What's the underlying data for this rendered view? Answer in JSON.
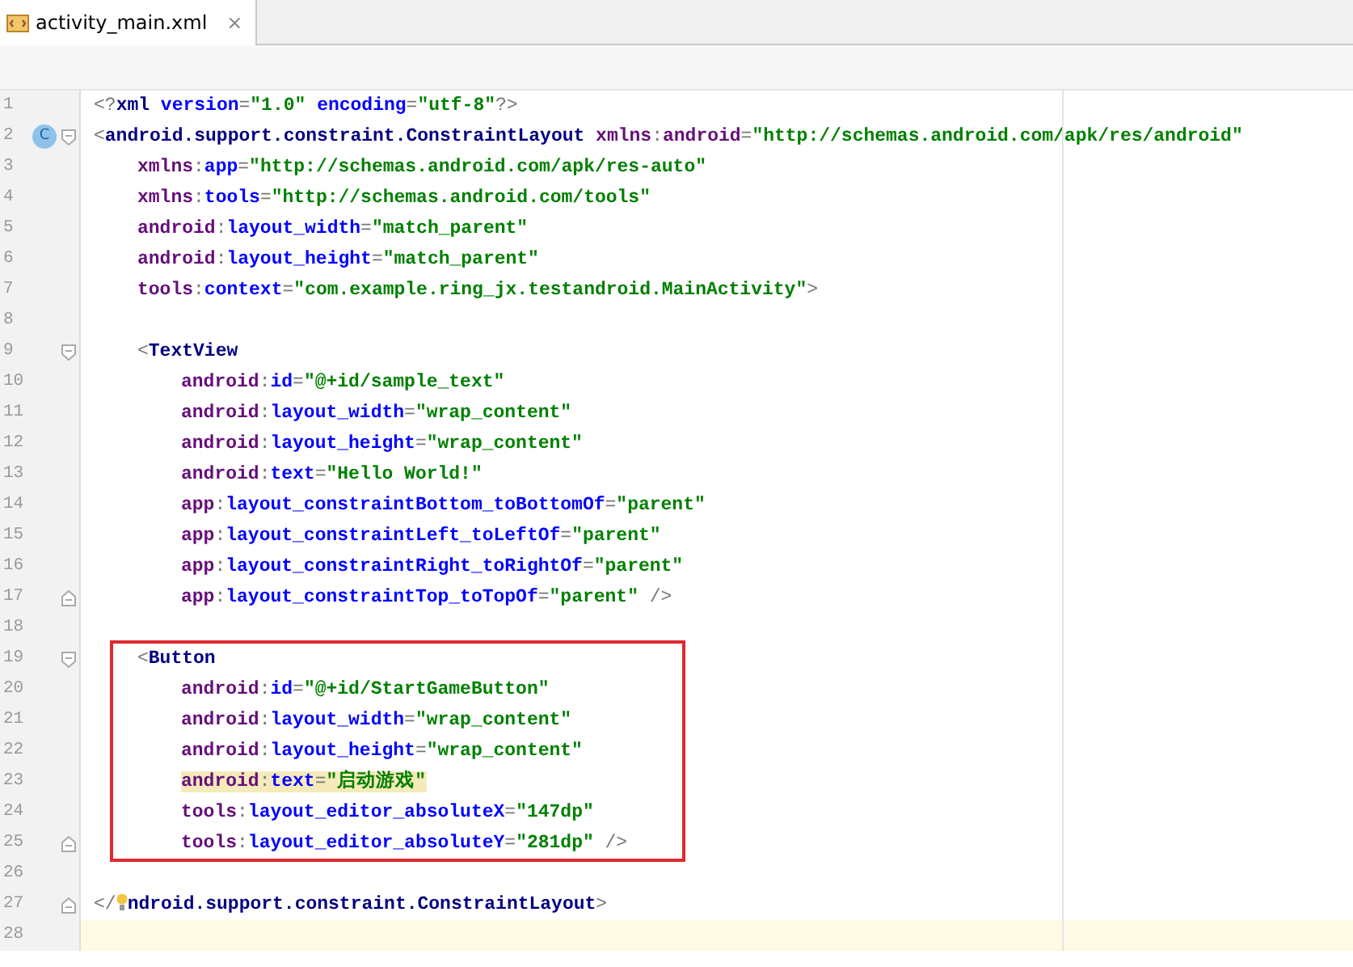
{
  "tab": {
    "title": "activity_main.xml",
    "close": "×",
    "selected": true
  },
  "lines": [
    {
      "number": "1",
      "tokens": [
        {
          "kind": "punct",
          "text": "<?"
        },
        {
          "kind": "tag",
          "text": "xml"
        },
        {
          "kind": "attr",
          "text": " version"
        },
        {
          "kind": "punct",
          "text": "="
        },
        {
          "kind": "value",
          "text": "\"1.0\""
        },
        {
          "kind": "attr",
          "text": " encoding"
        },
        {
          "kind": "punct",
          "text": "="
        },
        {
          "kind": "value",
          "text": "\"utf-8\""
        },
        {
          "kind": "punct",
          "text": "?>"
        }
      ]
    },
    {
      "number": "2",
      "badge": "C",
      "fold_start": true,
      "tokens": [
        {
          "kind": "punct",
          "text": "<"
        },
        {
          "kind": "tag",
          "text": "android.support.constraint.ConstraintLayout"
        },
        {
          "kind": "ns",
          "text": " xmlns"
        },
        {
          "kind": "punct",
          "text": ":"
        },
        {
          "kind": "ns",
          "text": "android"
        },
        {
          "kind": "punct",
          "text": "="
        },
        {
          "kind": "value",
          "text": "\"http://schemas.android.com/apk/res/android\""
        }
      ],
      "children": [
        {
          "number": "3",
          "tokens": [
            {
              "kind": "ns",
              "text": "xmlns"
            },
            {
              "kind": "punct",
              "text": ":"
            },
            {
              "kind": "attr",
              "text": "app"
            },
            {
              "kind": "punct",
              "text": "="
            },
            {
              "kind": "value",
              "text": "\"http://schemas.android.com/apk/res-auto\""
            }
          ]
        },
        {
          "number": "4",
          "tokens": [
            {
              "kind": "ns",
              "text": "xmlns"
            },
            {
              "kind": "punct",
              "text": ":"
            },
            {
              "kind": "attr",
              "text": "tools"
            },
            {
              "kind": "punct",
              "text": "="
            },
            {
              "kind": "value",
              "text": "\"http://schemas.android.com/tools\""
            }
          ]
        },
        {
          "number": "5",
          "tokens": [
            {
              "kind": "ns",
              "text": "android"
            },
            {
              "kind": "punct",
              "text": ":"
            },
            {
              "kind": "attr",
              "text": "layout_width"
            },
            {
              "kind": "punct",
              "text": "="
            },
            {
              "kind": "value",
              "text": "\"match_parent\""
            }
          ]
        },
        {
          "number": "6",
          "tokens": [
            {
              "kind": "ns",
              "text": "android"
            },
            {
              "kind": "punct",
              "text": ":"
            },
            {
              "kind": "attr",
              "text": "layout_height"
            },
            {
              "kind": "punct",
              "text": "="
            },
            {
              "kind": "value",
              "text": "\"match_parent\""
            }
          ]
        },
        {
          "number": "7",
          "tokens": [
            {
              "kind": "ns",
              "text": "tools"
            },
            {
              "kind": "punct",
              "text": ":"
            },
            {
              "kind": "attr",
              "text": "context"
            },
            {
              "kind": "punct",
              "text": "="
            },
            {
              "kind": "value",
              "text": "\"com.example.ring_jx.testandroid.MainActivity\""
            },
            {
              "kind": "punct",
              "text": ">"
            }
          ]
        },
        {
          "number": "8"
        },
        {
          "number": "9",
          "fold_start": true,
          "tokens": [
            {
              "kind": "punct",
              "text": "<"
            },
            {
              "kind": "tag",
              "text": "TextView"
            }
          ],
          "children": [
            {
              "number": "10",
              "tokens": [
                {
                  "kind": "ns",
                  "text": "android"
                },
                {
                  "kind": "punct",
                  "text": ":"
                },
                {
                  "kind": "attr",
                  "text": "id"
                },
                {
                  "kind": "punct",
                  "text": "="
                },
                {
                  "kind": "value",
                  "text": "\"@+id/sample_text\""
                }
              ]
            },
            {
              "number": "11",
              "tokens": [
                {
                  "kind": "ns",
                  "text": "android"
                },
                {
                  "kind": "punct",
                  "text": ":"
                },
                {
                  "kind": "attr",
                  "text": "layout_width"
                },
                {
                  "kind": "punct",
                  "text": "="
                },
                {
                  "kind": "value",
                  "text": "\"wrap_content\""
                }
              ]
            },
            {
              "number": "12",
              "tokens": [
                {
                  "kind": "ns",
                  "text": "android"
                },
                {
                  "kind": "punct",
                  "text": ":"
                },
                {
                  "kind": "attr",
                  "text": "layout_height"
                },
                {
                  "kind": "punct",
                  "text": "="
                },
                {
                  "kind": "value",
                  "text": "\"wrap_content\""
                }
              ]
            },
            {
              "number": "13",
              "tokens": [
                {
                  "kind": "ns",
                  "text": "android"
                },
                {
                  "kind": "punct",
                  "text": ":"
                },
                {
                  "kind": "attr",
                  "text": "text"
                },
                {
                  "kind": "punct",
                  "text": "="
                },
                {
                  "kind": "value",
                  "text": "\"Hello World!\""
                }
              ]
            },
            {
              "number": "14",
              "tokens": [
                {
                  "kind": "ns",
                  "text": "app"
                },
                {
                  "kind": "punct",
                  "text": ":"
                },
                {
                  "kind": "attr",
                  "text": "layout_constraintBottom_toBottomOf"
                },
                {
                  "kind": "punct",
                  "text": "="
                },
                {
                  "kind": "value",
                  "text": "\"parent\""
                }
              ]
            },
            {
              "number": "15",
              "tokens": [
                {
                  "kind": "ns",
                  "text": "app"
                },
                {
                  "kind": "punct",
                  "text": ":"
                },
                {
                  "kind": "attr",
                  "text": "layout_constraintLeft_toLeftOf"
                },
                {
                  "kind": "punct",
                  "text": "="
                },
                {
                  "kind": "value",
                  "text": "\"parent\""
                }
              ]
            },
            {
              "number": "16",
              "tokens": [
                {
                  "kind": "ns",
                  "text": "app"
                },
                {
                  "kind": "punct",
                  "text": ":"
                },
                {
                  "kind": "attr",
                  "text": "layout_constraintRight_toRightOf"
                },
                {
                  "kind": "punct",
                  "text": "="
                },
                {
                  "kind": "value",
                  "text": "\"parent\""
                }
              ]
            },
            {
              "number": "17",
              "fold_end": true,
              "tokens": [
                {
                  "kind": "ns",
                  "text": "app"
                },
                {
                  "kind": "punct",
                  "text": ":"
                },
                {
                  "kind": "attr",
                  "text": "layout_constraintTop_toTopOf"
                },
                {
                  "kind": "punct",
                  "text": "="
                },
                {
                  "kind": "value",
                  "text": "\"parent\""
                },
                {
                  "kind": "punct",
                  "text": " />"
                }
              ]
            }
          ]
        },
        {
          "number": "18"
        },
        {
          "number": "19",
          "fold_start": true,
          "boxed": true,
          "tokens": [
            {
              "kind": "punct",
              "text": "<"
            },
            {
              "kind": "tag",
              "text": "Button"
            }
          ],
          "children": [
            {
              "number": "20",
              "tokens": [
                {
                  "kind": "ns",
                  "text": "android"
                },
                {
                  "kind": "punct",
                  "text": ":"
                },
                {
                  "kind": "attr",
                  "text": "id"
                },
                {
                  "kind": "punct",
                  "text": "="
                },
                {
                  "kind": "value",
                  "text": "\"@+id/StartGameButton\""
                }
              ]
            },
            {
              "number": "21",
              "tokens": [
                {
                  "kind": "ns",
                  "text": "android"
                },
                {
                  "kind": "punct",
                  "text": ":"
                },
                {
                  "kind": "attr",
                  "text": "layout_width"
                },
                {
                  "kind": "punct",
                  "text": "="
                },
                {
                  "kind": "value",
                  "text": "\"wrap_content\""
                }
              ]
            },
            {
              "number": "22",
              "tokens": [
                {
                  "kind": "ns",
                  "text": "android"
                },
                {
                  "kind": "punct",
                  "text": ":"
                },
                {
                  "kind": "attr",
                  "text": "layout_height"
                },
                {
                  "kind": "punct",
                  "text": "="
                },
                {
                  "kind": "value",
                  "text": "\"wrap_content\""
                }
              ]
            },
            {
              "number": "23",
              "highlighted": true,
              "tokens": [
                {
                  "kind": "ns",
                  "text": "android"
                },
                {
                  "kind": "punct",
                  "text": ":"
                },
                {
                  "kind": "attr",
                  "text": "text"
                },
                {
                  "kind": "punct",
                  "text": "="
                },
                {
                  "kind": "value",
                  "text": "\"启动游戏\""
                }
              ]
            },
            {
              "number": "24",
              "tokens": [
                {
                  "kind": "ns",
                  "text": "tools"
                },
                {
                  "kind": "punct",
                  "text": ":"
                },
                {
                  "kind": "attr",
                  "text": "layout_editor_absoluteX"
                },
                {
                  "kind": "punct",
                  "text": "="
                },
                {
                  "kind": "value",
                  "text": "\"147dp\""
                }
              ]
            },
            {
              "number": "25",
              "fold_end": true,
              "tokens": [
                {
                  "kind": "ns",
                  "text": "tools"
                },
                {
                  "kind": "punct",
                  "text": ":"
                },
                {
                  "kind": "attr",
                  "text": "layout_editor_absoluteY"
                },
                {
                  "kind": "punct",
                  "text": "="
                },
                {
                  "kind": "value",
                  "text": "\"281dp\""
                },
                {
                  "kind": "punct",
                  "text": " />"
                }
              ]
            }
          ]
        },
        {
          "number": "26"
        }
      ]
    },
    {
      "number": "27",
      "fold_end": true,
      "tokens": [
        {
          "kind": "punct",
          "text": "</"
        },
        {
          "kind": "bulb"
        },
        {
          "kind": "tag",
          "text": "ndroid.support.constraint.ConstraintLayout"
        },
        {
          "kind": "punct",
          "text": ">"
        }
      ]
    },
    {
      "number": "28",
      "current": true
    }
  ]
}
